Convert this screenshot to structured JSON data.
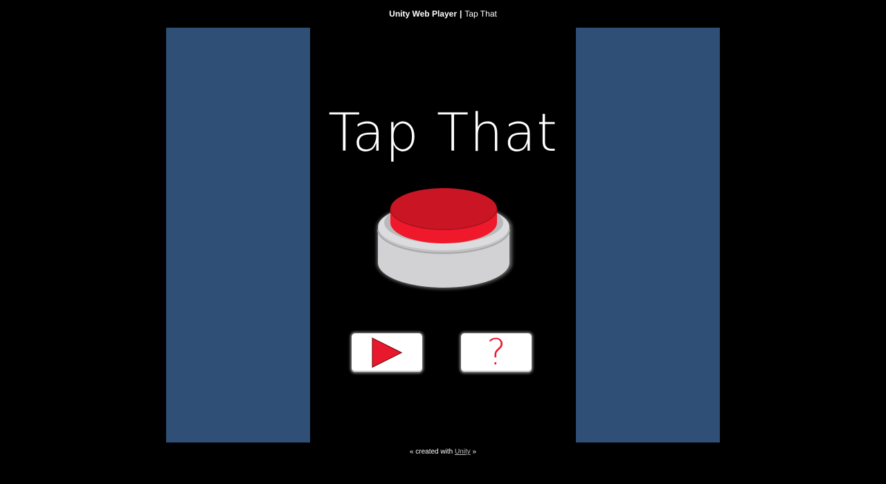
{
  "header": {
    "brand": "Unity Web Player",
    "separator": "|",
    "page_title": "Tap That"
  },
  "game": {
    "title": "Tap That",
    "big_button_icon": "red-push-button-icon",
    "play_button_icon": "play-icon",
    "help_button_text": "?",
    "help_button_icon": "question-mark-icon"
  },
  "footer": {
    "prefix": "« created with",
    "link_text": "Unity",
    "suffix": "»"
  },
  "colors": {
    "page_background": "#000000",
    "player_background": "#2f4f76",
    "button_red": "#e8192c",
    "button_base": "#d2d2d4"
  }
}
